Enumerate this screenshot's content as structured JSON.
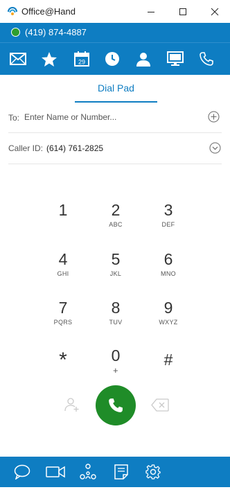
{
  "window": {
    "title": "Office@Hand",
    "controls": [
      "minimize",
      "maximize",
      "close"
    ]
  },
  "status": {
    "phone_number": "(419) 874-4887",
    "presence_color": "#2e9e2e"
  },
  "nav": {
    "icons": [
      "messages-icon",
      "favorites-icon",
      "calendar-icon",
      "history-icon",
      "contacts-icon",
      "meetings-icon",
      "phone-icon"
    ],
    "calendar_day": "29"
  },
  "tabs": {
    "active": "Dial Pad"
  },
  "dialer": {
    "to_label": "To:",
    "to_placeholder": "Enter Name or Number...",
    "caller_id_label": "Caller ID:",
    "caller_id_value": "(614) 761-2825"
  },
  "keypad": [
    {
      "digit": "1",
      "letters": ""
    },
    {
      "digit": "2",
      "letters": "ABC"
    },
    {
      "digit": "3",
      "letters": "DEF"
    },
    {
      "digit": "4",
      "letters": "GHI"
    },
    {
      "digit": "5",
      "letters": "JKL"
    },
    {
      "digit": "6",
      "letters": "MNO"
    },
    {
      "digit": "7",
      "letters": "PQRS"
    },
    {
      "digit": "8",
      "letters": "TUV"
    },
    {
      "digit": "9",
      "letters": "WXYZ"
    },
    {
      "digit": "*",
      "letters": ""
    },
    {
      "digit": "0",
      "letters": "+"
    },
    {
      "digit": "#",
      "letters": ""
    }
  ],
  "bottom_nav": {
    "icons": [
      "chat-icon",
      "video-icon",
      "conference-icon",
      "notes-icon",
      "settings-icon"
    ]
  },
  "colors": {
    "brand_blue": "#0e7dc2",
    "call_green": "#1f8c28"
  }
}
